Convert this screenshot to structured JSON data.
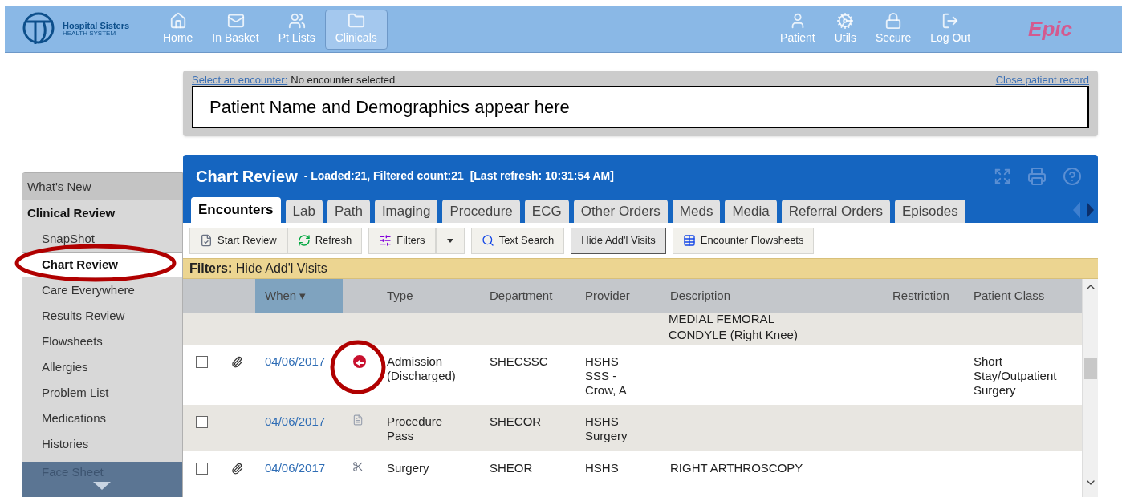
{
  "topbar": {
    "org_name": "Hospital Sisters",
    "org_sub": "HEALTH SYSTEM",
    "nav_left": [
      {
        "label": "Home",
        "selected": false
      },
      {
        "label": "In Basket",
        "selected": false
      },
      {
        "label": "Pt Lists",
        "selected": false
      },
      {
        "label": "Clinicals",
        "selected": true
      }
    ],
    "nav_right": [
      {
        "label": "Patient"
      },
      {
        "label": "Utils"
      },
      {
        "label": "Secure"
      },
      {
        "label": "Log Out"
      }
    ],
    "brand": "Epic"
  },
  "encounter_bar": {
    "link": "Select an encounter:",
    "status": "No encounter selected",
    "close_link": "Close patient record",
    "patient_placeholder": "Patient Name and Demographics appear here"
  },
  "sidebar": {
    "header": "What's New",
    "section": "Clinical Review",
    "items": [
      {
        "label": "SnapShot",
        "selected": false
      },
      {
        "label": "Chart Review",
        "selected": true
      },
      {
        "label": "Care Everywhere",
        "selected": false
      },
      {
        "label": "Results Review",
        "selected": false
      },
      {
        "label": "Flowsheets",
        "selected": false
      },
      {
        "label": "Allergies",
        "selected": false
      },
      {
        "label": "Problem List",
        "selected": false
      },
      {
        "label": "Medications",
        "selected": false
      },
      {
        "label": "Histories",
        "selected": false
      }
    ],
    "footer_item": "Face Sheet"
  },
  "chart_review": {
    "title": "Chart Review",
    "summary": "- Loaded:21, Filtered count:21  [Last refresh: 10:31:54 AM]",
    "tabs": [
      {
        "label": "Encounters",
        "selected": true
      },
      {
        "label": "Lab",
        "selected": false
      },
      {
        "label": "Path",
        "selected": false
      },
      {
        "label": "Imaging",
        "selected": false
      },
      {
        "label": "Procedure",
        "selected": false
      },
      {
        "label": "ECG",
        "selected": false
      },
      {
        "label": "Other Orders",
        "selected": false
      },
      {
        "label": "Meds",
        "selected": false
      },
      {
        "label": "Media",
        "selected": false
      },
      {
        "label": "Referral Orders",
        "selected": false
      },
      {
        "label": "Episodes",
        "selected": false
      }
    ],
    "toolbar": [
      {
        "label": "Start Review",
        "kind": "review",
        "pressed": false
      },
      {
        "label": "Refresh",
        "kind": "refresh",
        "pressed": false
      },
      {
        "label": "Filters",
        "kind": "filters",
        "pressed": false
      },
      {
        "label": "Text Search",
        "kind": "search",
        "pressed": false
      },
      {
        "label": "Hide Add'l Visits",
        "kind": "plain",
        "pressed": true
      },
      {
        "label": "Encounter Flowsheets",
        "kind": "grid",
        "pressed": false
      }
    ],
    "filter_label": "Filters:",
    "filter_value": "Hide Add'l Visits",
    "columns": [
      {
        "label": "When ▾",
        "sorted": true
      },
      {
        "label": "Type",
        "sorted": false
      },
      {
        "label": "Department",
        "sorted": false
      },
      {
        "label": "Provider",
        "sorted": false
      },
      {
        "label": "Description",
        "sorted": false
      },
      {
        "label": "Restriction",
        "sorted": false
      },
      {
        "label": "Patient Class",
        "sorted": false
      }
    ],
    "rows": [
      {
        "kind": "partial",
        "description": "MEDIAL FEMORAL CONDYLE (Right Knee)"
      },
      {
        "kind": "admission",
        "checked": false,
        "attachment": true,
        "date": "04/06/2017",
        "type": "Admission (Discharged)",
        "department": "SHECSSC",
        "provider": "HSHS SSS - Crow, A",
        "patient_class": "Short Stay/Outpatient Surgery"
      },
      {
        "kind": "document",
        "checked": false,
        "attachment": false,
        "date": "04/06/2017",
        "type": "Procedure Pass",
        "department": "SHECOR",
        "provider": "HSHS Surgery"
      },
      {
        "kind": "surgery",
        "checked": false,
        "attachment": true,
        "date": "04/06/2017",
        "type": "Surgery",
        "department": "SHEOR",
        "provider": "HSHS",
        "description": "RIGHT ARTHROSCOPY"
      }
    ]
  }
}
